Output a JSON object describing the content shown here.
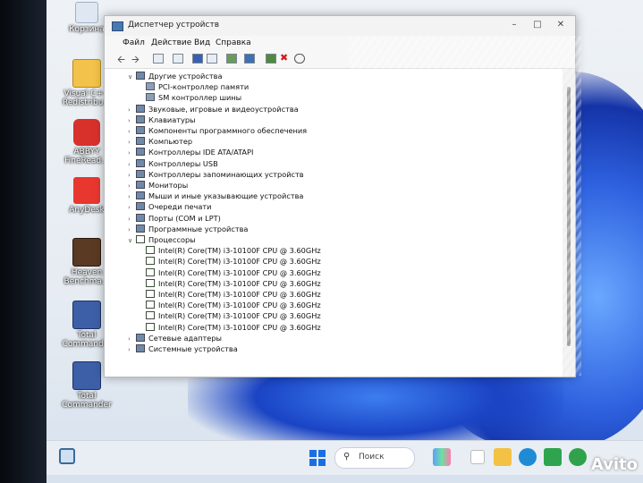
{
  "desktop": {
    "icons": [
      {
        "label": "Корзина"
      },
      {
        "label": "Visual C++ Redistribu..."
      },
      {
        "label": "ABBYY FineRead..."
      },
      {
        "label": "AnyDesk"
      },
      {
        "label": "Heaven Benchma..."
      },
      {
        "label": "Total Command..."
      },
      {
        "label": "Total Commander"
      }
    ]
  },
  "window": {
    "title": "Диспетчер устройств",
    "menu": [
      "Файл",
      "Действие",
      "Вид",
      "Справка"
    ],
    "tree": [
      {
        "label": "Другие устройства",
        "level": 1,
        "state": "expanded"
      },
      {
        "label": "PCI-контроллер памяти",
        "level": 2
      },
      {
        "label": "SM контроллер шины",
        "level": 2
      },
      {
        "label": "Звуковые, игровые и видеоустройства",
        "level": 1,
        "state": "collapsed"
      },
      {
        "label": "Клавиатуры",
        "level": 1,
        "state": "collapsed"
      },
      {
        "label": "Компоненты программного обеспечения",
        "level": 1,
        "state": "collapsed"
      },
      {
        "label": "Компьютер",
        "level": 1,
        "state": "collapsed"
      },
      {
        "label": "Контроллеры IDE ATA/ATAPI",
        "level": 1,
        "state": "collapsed"
      },
      {
        "label": "Контроллеры USB",
        "level": 1,
        "state": "collapsed"
      },
      {
        "label": "Контроллеры запоминающих устройств",
        "level": 1,
        "state": "collapsed"
      },
      {
        "label": "Мониторы",
        "level": 1,
        "state": "collapsed"
      },
      {
        "label": "Мыши и иные указывающие устройства",
        "level": 1,
        "state": "collapsed"
      },
      {
        "label": "Очереди печати",
        "level": 1,
        "state": "collapsed"
      },
      {
        "label": "Порты (COM и LPT)",
        "level": 1,
        "state": "collapsed"
      },
      {
        "label": "Программные устройства",
        "level": 1,
        "state": "collapsed"
      },
      {
        "label": "Процессоры",
        "level": 1,
        "state": "expanded"
      },
      {
        "label": "Intel(R) Core(TM) i3-10100F CPU @ 3.60GHz",
        "level": 2
      },
      {
        "label": "Intel(R) Core(TM) i3-10100F CPU @ 3.60GHz",
        "level": 2
      },
      {
        "label": "Intel(R) Core(TM) i3-10100F CPU @ 3.60GHz",
        "level": 2
      },
      {
        "label": "Intel(R) Core(TM) i3-10100F CPU @ 3.60GHz",
        "level": 2
      },
      {
        "label": "Intel(R) Core(TM) i3-10100F CPU @ 3.60GHz",
        "level": 2
      },
      {
        "label": "Intel(R) Core(TM) i3-10100F CPU @ 3.60GHz",
        "level": 2
      },
      {
        "label": "Intel(R) Core(TM) i3-10100F CPU @ 3.60GHz",
        "level": 2
      },
      {
        "label": "Intel(R) Core(TM) i3-10100F CPU @ 3.60GHz",
        "level": 2
      },
      {
        "label": "Сетевые адаптеры",
        "level": 1,
        "state": "collapsed"
      },
      {
        "label": "Системные устройства",
        "level": 1,
        "state": "collapsed"
      }
    ]
  },
  "taskbar": {
    "search_label": "Поиск"
  },
  "watermark": "Avito",
  "colors": {
    "accent": "#1a6fe0",
    "wallpaper_blue": "#2f62e0"
  }
}
